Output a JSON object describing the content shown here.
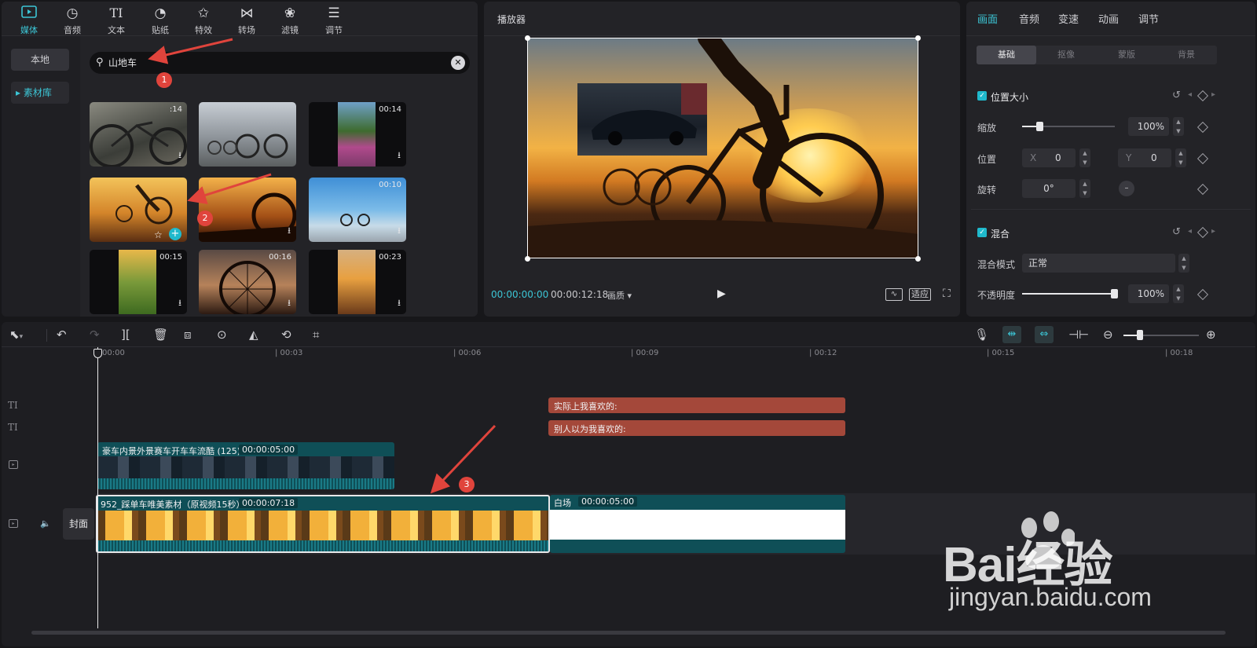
{
  "media_toolbar": {
    "items": [
      {
        "label": "媒体",
        "icon": "media-icon"
      },
      {
        "label": "音频",
        "icon": "audio-icon"
      },
      {
        "label": "文本",
        "icon": "text-icon"
      },
      {
        "label": "贴纸",
        "icon": "sticker-icon"
      },
      {
        "label": "特效",
        "icon": "effects-icon"
      },
      {
        "label": "转场",
        "icon": "transition-icon"
      },
      {
        "label": "滤镜",
        "icon": "filter-icon"
      },
      {
        "label": "调节",
        "icon": "adjust-icon"
      }
    ],
    "active": "媒体",
    "accent_color": "#3cc6d6"
  },
  "media_sidebar": {
    "local": "本地",
    "library": "▸ 素材库"
  },
  "search": {
    "value": "山地车"
  },
  "thumbnails": [
    {
      "duration": ":14",
      "download": true
    },
    {
      "duration": "",
      "download": false
    },
    {
      "duration": "00:14",
      "download": true
    },
    {
      "duration": "",
      "download": false
    },
    {
      "duration": "",
      "download": true
    },
    {
      "duration": "00:10",
      "download": true
    },
    {
      "duration": "00:15",
      "download": true
    },
    {
      "duration": "00:16",
      "download": true
    },
    {
      "duration": "00:23",
      "download": true
    }
  ],
  "player": {
    "title": "播放器",
    "current_time": "00:00:00:00",
    "total_time": "00:00:12:18",
    "quality": "画质 ▾",
    "fit": "适应"
  },
  "inspector": {
    "tabs": [
      "画面",
      "音频",
      "变速",
      "动画",
      "调节"
    ],
    "active_tab": "画面",
    "sub_tabs": [
      "基础",
      "抠像",
      "蒙版",
      "背景"
    ],
    "active_sub_tab": "基础",
    "position_size": {
      "title": "位置大小",
      "scale_label": "缩放",
      "scale_value": "100%",
      "scale_fraction": 0.15,
      "position_label": "位置",
      "x_label": "X",
      "x_value": "0",
      "y_label": "Y",
      "y_value": "0",
      "rotate_label": "旋转",
      "rotate_value": "0°"
    },
    "blend": {
      "title": "混合",
      "mode_label": "混合模式",
      "mode_value": "正常",
      "opacity_label": "不透明度",
      "opacity_value": "100%",
      "opacity_fraction": 1.0
    }
  },
  "timeline": {
    "ticks": [
      "00:00",
      "| 00:03",
      "| 00:06",
      "| 00:09",
      "| 00:12",
      "| 00:15",
      "| 00:18"
    ],
    "text_clips": [
      {
        "label": "实际上我喜欢的:"
      },
      {
        "label": "别人以为我喜欢的:"
      }
    ],
    "overlay_clip": {
      "label": "豪车内景外景赛车开车车流酷 (125)",
      "duration": "00:00:05:00"
    },
    "main_clip": {
      "label": "952_踩单车唯美素材（原视频15秒）",
      "duration": "00:00:07:18"
    },
    "white_clip": {
      "label": "白场",
      "duration": "00:00:05:00"
    },
    "cover_label": "封面"
  },
  "annotations": {
    "markers": [
      "1",
      "2",
      "3"
    ],
    "color": "#e0443c"
  },
  "watermark": {
    "brand": "Bai经验",
    "url": "jingyan.baidu.com"
  }
}
